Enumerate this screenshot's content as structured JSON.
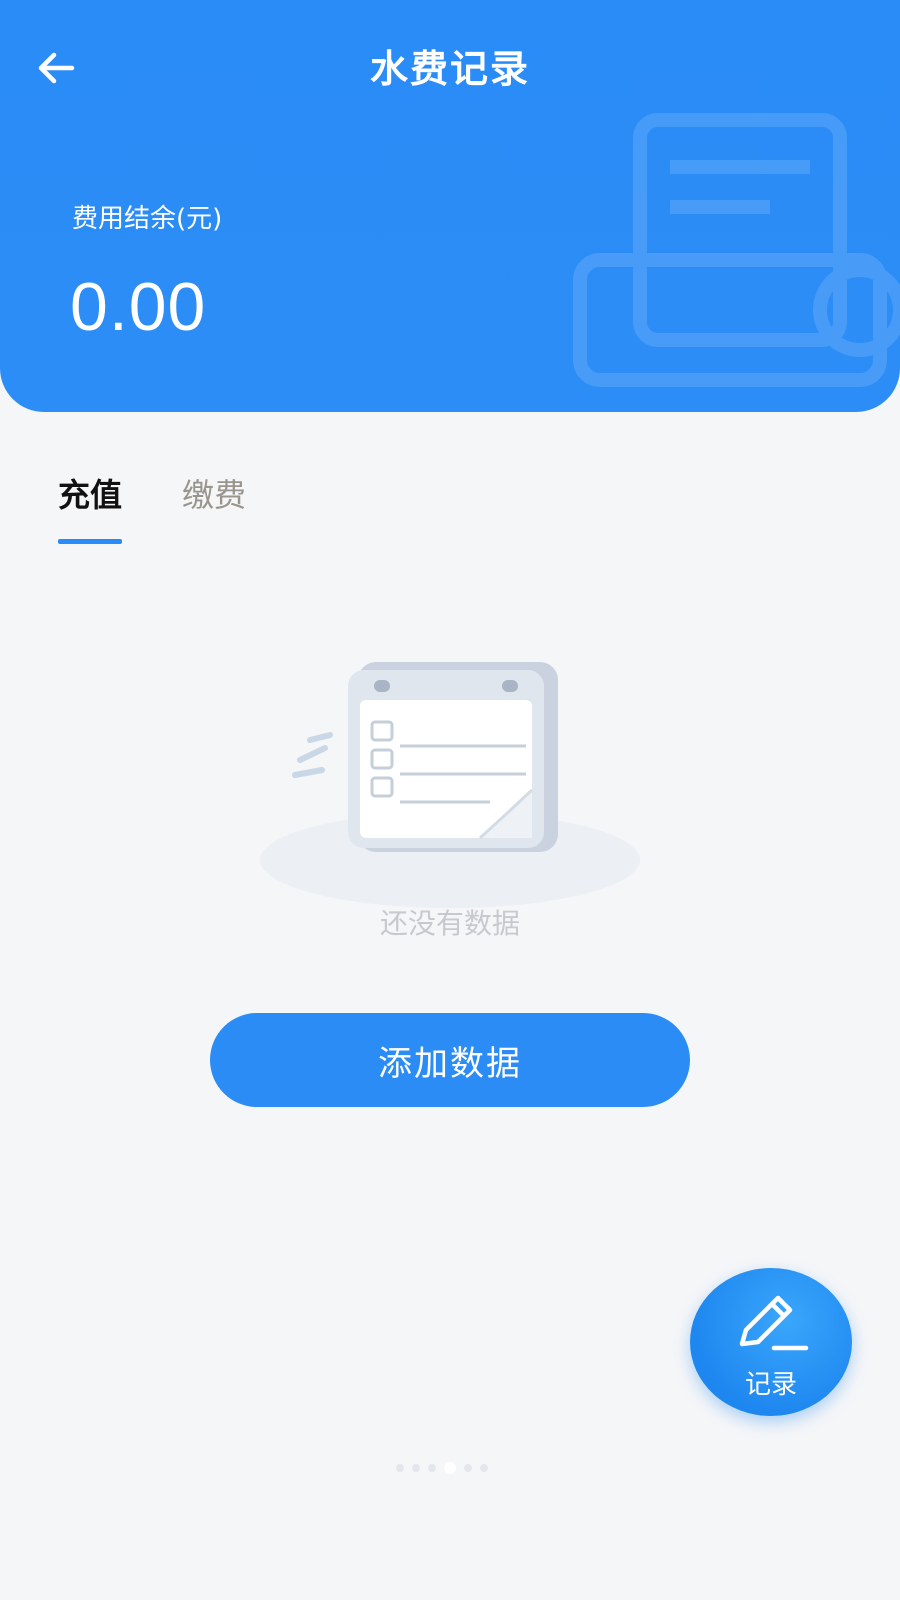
{
  "header": {
    "title": "水费记录",
    "back_icon": "arrow-left-icon",
    "balance_label": "费用结余(元)",
    "balance_value": "0.00",
    "background_color": "#2a8cf7"
  },
  "tabs": [
    {
      "label": "充值",
      "active": true
    },
    {
      "label": "缴费",
      "active": false
    }
  ],
  "empty_state": {
    "illustration": "empty-calendar-icon",
    "text": "还没有数据"
  },
  "add_button": {
    "label": "添加数据"
  },
  "fab": {
    "icon": "pencil-icon",
    "label": "记录"
  },
  "colors": {
    "accent": "#2a8cf7",
    "active_tab_text": "#111111",
    "inactive_tab_text": "#9a958c",
    "background": "#f5f6f8"
  }
}
